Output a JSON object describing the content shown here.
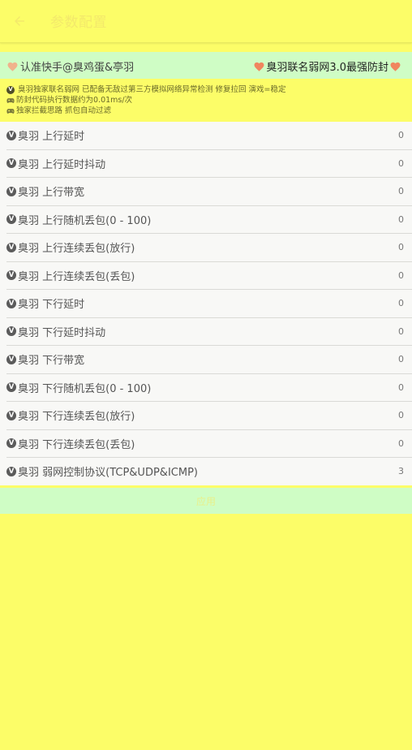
{
  "appbar": {
    "title": "参数配置"
  },
  "banner": {
    "left": "认准快手@臭鸡蛋&亭羽",
    "right": "臭羽联名弱网3.0最强防封"
  },
  "info": {
    "lines": [
      "臭羽独家联名弱网 已配备无敌过第三方模拟网络异常检测 修复拉回 演戏=稳定",
      "防封代码执行数据约为0.01ms/次",
      "独家拦截思路 抓包自动过滤"
    ]
  },
  "rows": [
    {
      "label": "臭羽 上行延时",
      "value": "0"
    },
    {
      "label": "臭羽 上行延时抖动",
      "value": "0"
    },
    {
      "label": "臭羽 上行带宽",
      "value": "0"
    },
    {
      "label": "臭羽 上行随机丢包(0 - 100)",
      "value": "0"
    },
    {
      "label": "臭羽 上行连续丢包(放行)",
      "value": "0"
    },
    {
      "label": "臭羽 上行连续丢包(丢包)",
      "value": "0"
    },
    {
      "label": "臭羽 下行延时",
      "value": "0"
    },
    {
      "label": "臭羽 下行延时抖动",
      "value": "0"
    },
    {
      "label": "臭羽 下行带宽",
      "value": "0"
    },
    {
      "label": "臭羽 下行随机丢包(0 - 100)",
      "value": "0"
    },
    {
      "label": "臭羽 下行连续丢包(放行)",
      "value": "0"
    },
    {
      "label": "臭羽 下行连续丢包(丢包)",
      "value": "0"
    },
    {
      "label": "臭羽 弱网控制协议(TCP&UDP&ICMP)",
      "value": "3"
    }
  ],
  "apply_label": "应用",
  "colors": {
    "background": "#FCFD68",
    "banner": "#CFFDC5",
    "heart": "#F0865E"
  },
  "icons": {
    "back": "arrow-left-icon",
    "heart": "heart-icon",
    "row": "v-badge-icon",
    "gamepad": "gamepad-icon"
  }
}
